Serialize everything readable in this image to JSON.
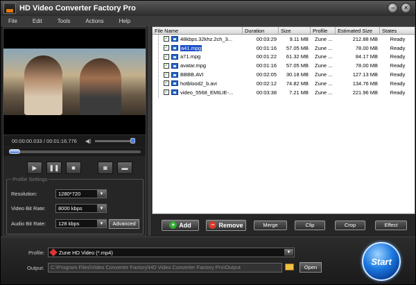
{
  "window": {
    "title": "HD Video Converter Factory Pro"
  },
  "menu": [
    "File",
    "Edit",
    "Tools",
    "Actions",
    "Help"
  ],
  "player": {
    "time": "00:00:00.033 / 00:01:16.776",
    "volume_pct": 100,
    "seek_pct": 0
  },
  "profile_settings": {
    "title": "Profile Settings",
    "resolution_label": "Resolution:",
    "resolution_value": "1280*720",
    "video_bitrate_label": "Video Bit Rate:",
    "video_bitrate_value": "8000 kbps",
    "audio_bitrate_label": "Audio Bit Rate:",
    "audio_bitrate_value": "128 kbps",
    "advanced_label": "Advanced"
  },
  "file_table": {
    "columns": [
      "File Name",
      "Duration",
      "Size",
      "Profile",
      "Estimated Size",
      "States"
    ],
    "rows": [
      {
        "name": "48kbps.32khz.2ch_3...",
        "duration": "00:03:29",
        "size": "9.11 MB",
        "profile": "Zune ...",
        "est": "212.88 MB",
        "state": "Ready",
        "selected": false
      },
      {
        "name": "a41.mpg",
        "duration": "00:01:16",
        "size": "57.05 MB",
        "profile": "Zune ...",
        "est": "78.00 MB",
        "state": "Ready",
        "selected": true
      },
      {
        "name": "a71.mpg",
        "duration": "00:01:22",
        "size": "61.32 MB",
        "profile": "Zune ...",
        "est": "84.17 MB",
        "state": "Ready",
        "selected": false
      },
      {
        "name": "avatar.mpg",
        "duration": "00:01:16",
        "size": "57.05 MB",
        "profile": "Zune ...",
        "est": "78.00 MB",
        "state": "Ready",
        "selected": false
      },
      {
        "name": "BBBB.AVI",
        "duration": "00:02:05",
        "size": "30.18 MB",
        "profile": "Zune ...",
        "est": "127.13 MB",
        "state": "Ready",
        "selected": false
      },
      {
        "name": "hotblood2_b.avi",
        "duration": "00:02:12",
        "size": "74.82 MB",
        "profile": "Zune ...",
        "est": "134.76 MB",
        "state": "Ready",
        "selected": false
      },
      {
        "name": "video_5568_EMILIE-...",
        "duration": "00:03:38",
        "size": "7.21 MB",
        "profile": "Zune ...",
        "est": "221.96 MB",
        "state": "Ready",
        "selected": false
      }
    ]
  },
  "actions": {
    "add": "Add",
    "remove": "Remove",
    "merge": "Merge",
    "clip": "Clip",
    "crop": "Crop",
    "effect": "Effect"
  },
  "bottom": {
    "profile_label": "Profile:",
    "profile_value": "Zune HD Video (*.mp4)",
    "output_label": "Output:",
    "output_value": "C:\\Program Files\\Video Converter Factory\\HD Video Converter Factory Pro\\Output",
    "open_label": "Open",
    "start_label": "Start"
  }
}
